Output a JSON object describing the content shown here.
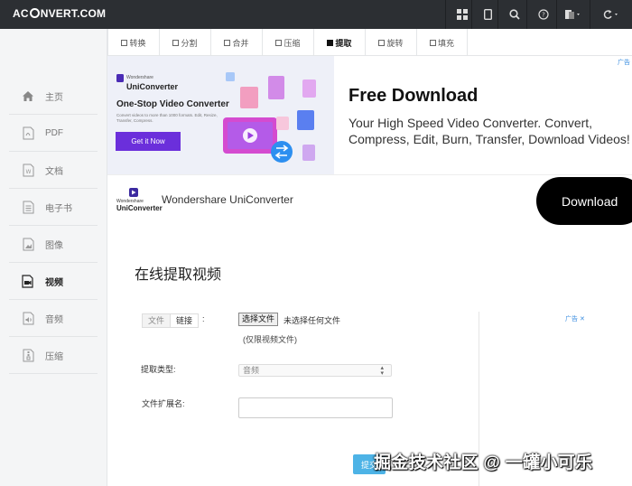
{
  "topbar": {
    "logo_left": "AC",
    "logo_right": "NVERT.COM",
    "icons": [
      "grid-icon",
      "tablet-icon",
      "search-icon",
      "help-icon",
      "language-icon",
      "refresh-icon"
    ]
  },
  "sidebar": {
    "items": [
      {
        "label": "主页",
        "icon": "home-icon"
      },
      {
        "label": "PDF",
        "icon": "pdf-file-icon"
      },
      {
        "label": "文档",
        "icon": "word-file-icon"
      },
      {
        "label": "电子书",
        "icon": "ebook-icon"
      },
      {
        "label": "图像",
        "icon": "image-icon"
      },
      {
        "label": "视频",
        "icon": "video-icon",
        "active": true
      },
      {
        "label": "音频",
        "icon": "audio-icon"
      },
      {
        "label": "压缩",
        "icon": "archive-icon"
      }
    ]
  },
  "tabs": [
    {
      "label": "转换"
    },
    {
      "label": "分割"
    },
    {
      "label": "合并"
    },
    {
      "label": "压缩"
    },
    {
      "label": "提取",
      "active": true
    },
    {
      "label": "旋转"
    },
    {
      "label": "填充"
    }
  ],
  "ad": {
    "brand_small": "Wondershare",
    "brand": "UniConverter",
    "one_stop": "One-Stop Video Converter",
    "one_stop_desc": "Convert videos to more than 1000 formats. Edit, Resize, Transfer, Compress.",
    "get_it": "Get it Now",
    "title": "Free Download",
    "subtitle": "Your High Speed Video Converter. Convert, Compress, Edit, Burn, Transfer, Download Videos!",
    "mark": "广告",
    "company": "Wondershare UniConverter",
    "download": "Download"
  },
  "main": {
    "title": "在线提取视频",
    "seg_file": "文件",
    "seg_link": "链接",
    "colon": ":",
    "choose_file": "选择文件",
    "no_file": "未选择任何文件",
    "hint": "(仅限视频文件)",
    "type_label": "提取类型:",
    "type_value": "音频",
    "ext_label": "文件扩展名:",
    "ad_mark": "广告 ✕",
    "submit": "提交"
  },
  "watermark": "掘金技术社区 @ 一罐小可乐",
  "colors": {
    "topbar": "#2c2f33",
    "sidebar": "#f4f5f6",
    "ad_button": "#6b2fdb",
    "submit": "#4db3e6"
  }
}
